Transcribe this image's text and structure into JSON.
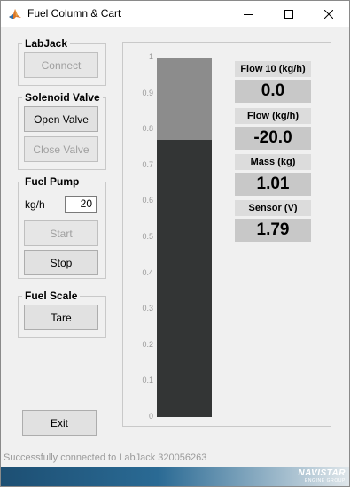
{
  "window": {
    "title": "Fuel Column & Cart"
  },
  "labjack": {
    "group_label": "LabJack",
    "connect_label": "Connect"
  },
  "solenoid": {
    "group_label": "Solenoid Valve",
    "open_label": "Open Valve",
    "close_label": "Close Valve"
  },
  "pump": {
    "group_label": "Fuel Pump",
    "unit_label": "kg/h",
    "rate_value": "20",
    "start_label": "Start",
    "stop_label": "Stop"
  },
  "scale": {
    "group_label": "Fuel Scale",
    "tare_label": "Tare"
  },
  "exit_label": "Exit",
  "gauge": {
    "ticks": [
      "1",
      "0.9",
      "0.8",
      "0.7",
      "0.6",
      "0.5",
      "0.4",
      "0.3",
      "0.2",
      "0.1",
      "0"
    ],
    "level": 0.77,
    "colors": {
      "fill": "#333535",
      "background": "#8c8c8c"
    }
  },
  "readouts": [
    {
      "title": "Flow 10 (kg/h)",
      "value": "0.0"
    },
    {
      "title": "Flow (kg/h)",
      "value": "-20.0"
    },
    {
      "title": "Mass (kg)",
      "value": "1.01"
    },
    {
      "title": "Sensor (V)",
      "value": "1.79"
    }
  ],
  "status": {
    "text": "Successfully connected to LabJack 320056263"
  },
  "brand": {
    "logo_line1": "NAVISTAR",
    "logo_line2": "ENGINE GROUP"
  }
}
